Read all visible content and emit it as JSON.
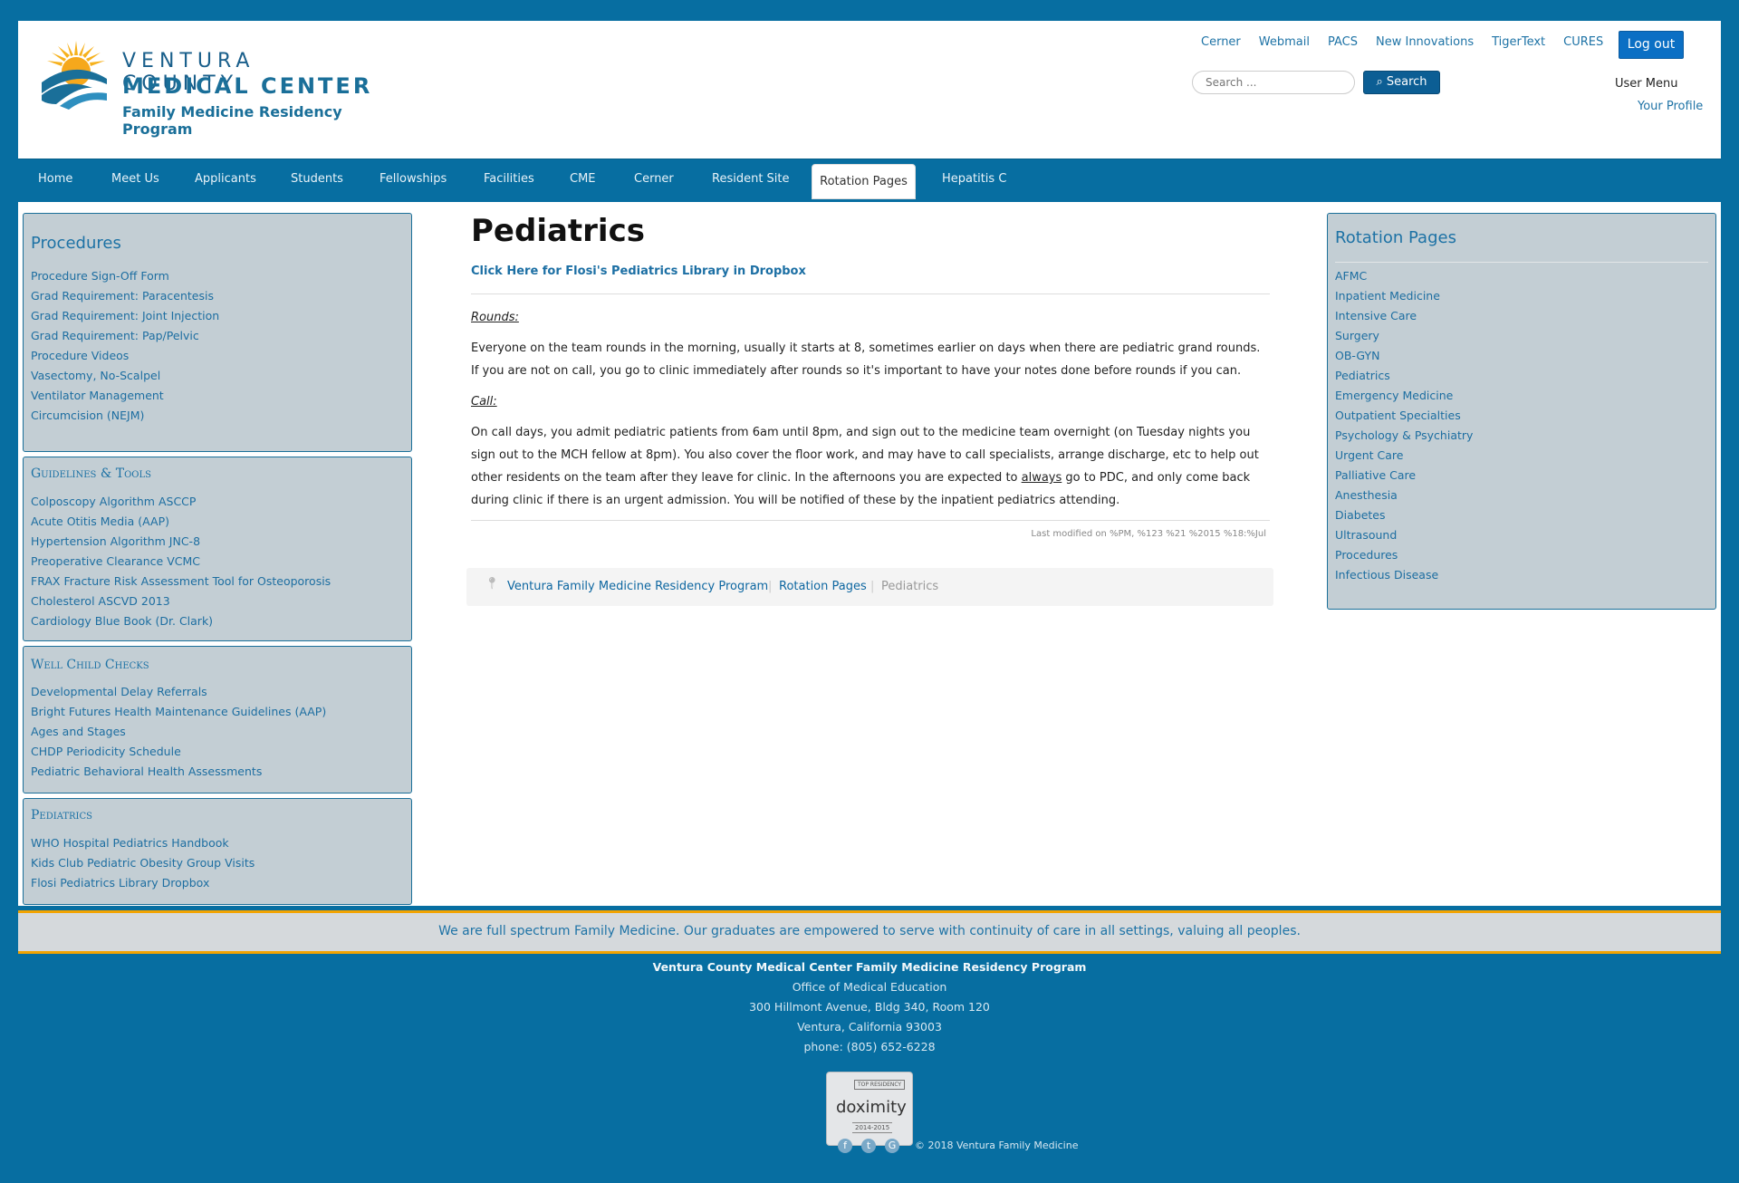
{
  "header": {
    "logo_line1": "VENTURA COUNTY",
    "logo_line2": "MEDICAL CENTER",
    "logo_line3": "Family Medicine Residency Program",
    "top_links": [
      "Cerner",
      "Webmail",
      "PACS",
      "New Innovations",
      "TigerText",
      "CURES"
    ],
    "logout_label": "Log out",
    "search_placeholder": "Search ...",
    "search_button_label": "Search",
    "user_menu_title": "User Menu",
    "your_profile_label": "Your Profile"
  },
  "nav": {
    "items": [
      "Home",
      "Meet Us",
      "Applicants",
      "Students",
      "Fellowships",
      "Facilities",
      "CME",
      "Cerner",
      "Resident Site",
      "Rotation Pages",
      "Hepatitis C"
    ],
    "active": "Rotation Pages"
  },
  "sidebar": {
    "procedures": {
      "title": "Procedures",
      "links": [
        "Procedure Sign-Off Form",
        "Grad Requirement: Paracentesis",
        "Grad Requirement: Joint Injection",
        "Grad Requirement: Pap/Pelvic",
        "Procedure Videos",
        "Vasectomy, No-Scalpel",
        "Ventilator Management",
        "Circumcision (NEJM)"
      ]
    },
    "guidelines": {
      "title": "Guidelines & Tools",
      "links": [
        "Colposcopy Algorithm ASCCP",
        "Acute Otitis Media (AAP)",
        "Hypertension Algorithm JNC-8",
        "Preoperative Clearance VCMC",
        "FRAX Fracture Risk Assessment Tool for Osteoporosis",
        "Cholesterol ASCVD 2013",
        "Cardiology Blue Book (Dr. Clark)"
      ]
    },
    "well_child": {
      "title": "Well Child Checks",
      "links": [
        "Developmental Delay Referrals",
        "Bright Futures Health Maintenance Guidelines (AAP)",
        "Ages and Stages",
        "CHDP Periodicity Schedule",
        "Pediatric Behavioral Health Assessments"
      ]
    },
    "pediatrics": {
      "title": "Pediatrics",
      "links": [
        "WHO Hospital Pediatrics Handbook",
        "Kids Club Pediatric Obesity Group Visits",
        "Flosi Pediatrics Library Dropbox"
      ]
    }
  },
  "article": {
    "title": "Pediatrics",
    "dropbox_link": "Click Here for Flosi's Pediatrics Library in Dropbox",
    "rounds_label": "Rounds:",
    "rounds_text": "Everyone on the team rounds in the morning, usually it starts at 8, sometimes earlier on days when there are pediatric grand rounds.  If you are not on call, you go to clinic immediately after rounds so it's important to have your notes done before rounds if you can.",
    "call_label": "Call:",
    "call_text_before": "On call days, you admit pediatric patients from 6am until 8pm, and sign out to the medicine team overnight (on Tuesday nights you sign out to the MCH fellow at 8pm).  You also cover the floor work, and may have to call specialists, arrange discharge, etc to help out other residents on the team after they leave for clinic.  In the afternoons you are expected to ",
    "call_text_emph": "always",
    "call_text_after": " go to PDC, and only come back during clinic if there is an urgent admission.  You will be notified of these by the inpatient pediatrics attending.",
    "last_modified": "Last modified on %PM, %123 %21 %2015 %18:%Jul"
  },
  "breadcrumb": {
    "items": [
      "Ventura Family Medicine Residency Program",
      "Rotation Pages",
      "Pediatrics"
    ]
  },
  "rotation_pages": {
    "title": "Rotation Pages",
    "links": [
      "AFMC",
      "Inpatient Medicine",
      "Intensive Care",
      "Surgery",
      "OB-GYN",
      "Pediatrics",
      "Emergency Medicine",
      "Outpatient Specialties",
      "Psychology & Psychiatry",
      "Urgent Care",
      "Palliative Care",
      "Anesthesia",
      "Diabetes",
      "Ultrasound",
      "Procedures"
    ],
    "small_link": "Infectious Disease"
  },
  "banner": {
    "text": "We are full spectrum Family Medicine. Our graduates are empowered to serve with continuity of care in all settings, valuing all peoples."
  },
  "footer": {
    "org": "Ventura County Medical Center Family Medicine Residency Program",
    "office": "Office of Medical Education",
    "address": "300 Hillmont Avenue, Bldg 340, Room 120",
    "city": "Ventura, California 93003",
    "phone": "phone: (805) 652-6228",
    "badge_top": "TOP RESIDENCY",
    "badge_brand": "doximity",
    "badge_years": "2014-2015",
    "copyright": "© 2018 Ventura Family Medicine"
  }
}
